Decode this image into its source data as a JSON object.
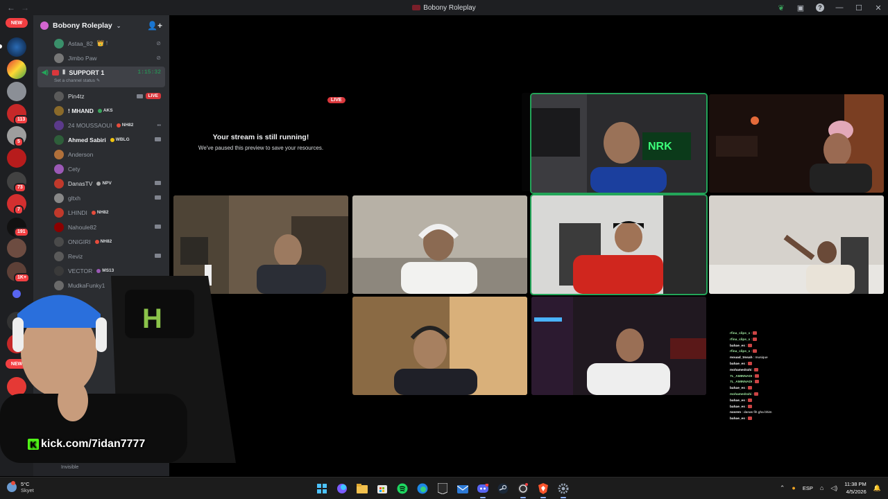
{
  "window": {
    "title": "Bobony Roleplay",
    "back_glyph": "←",
    "forward_glyph": "→",
    "controls": {
      "minimize": "—",
      "maximize": "☐",
      "close": "✕"
    },
    "icons": [
      "leaf-icon",
      "inbox-icon",
      "help-icon"
    ]
  },
  "rail": {
    "new_label": "NEW",
    "badges": [
      "113",
      "5",
      "73",
      "7",
      "191",
      "1K+"
    ]
  },
  "server": {
    "name": "Bobony Roleplay",
    "chevron": "⌄",
    "add_member_glyph": "👤+"
  },
  "voice_users_top": [
    {
      "name": "Astaa_82",
      "suffix": "👑 !"
    },
    {
      "name": "Jimbo Paw",
      "suffix": ""
    }
  ],
  "channel": {
    "name": "SUPPORT 1",
    "prefix": "Ⅱ",
    "timer": "1:15:32",
    "status": "Set a channel status ✎",
    "members": [
      {
        "name": "Pin4tz",
        "tag": "",
        "live": "LIVE"
      },
      {
        "name": "! MHAND",
        "tag": "AKS",
        "live": ""
      },
      {
        "name": "24 MOUSSAOUI",
        "tag": "NH82",
        "live": ""
      },
      {
        "name": "Ahmed Sabiri",
        "tag": "WBLG",
        "live": ""
      },
      {
        "name": "Anderson",
        "tag": "",
        "live": ""
      },
      {
        "name": "Cety",
        "tag": "",
        "live": ""
      },
      {
        "name": "DanasTV",
        "tag": "NPV",
        "live": ""
      },
      {
        "name": "gltxh",
        "tag": "",
        "live": ""
      },
      {
        "name": "LHINDI",
        "tag": "NH82",
        "live": ""
      },
      {
        "name": "Nahoule82",
        "tag": "",
        "live": ""
      },
      {
        "name": "ONIGIRI",
        "tag": "NH82",
        "live": ""
      },
      {
        "name": "Reviz",
        "tag": "",
        "live": ""
      },
      {
        "name": "VECTOR",
        "tag": "MS13",
        "live": ""
      },
      {
        "name": "MudkaFunky1",
        "tag": "",
        "live": ""
      }
    ]
  },
  "user_panel": {
    "status": "Invisible"
  },
  "stage": {
    "paused_title": "Your stream is still running!",
    "paused_sub": "We've paused this preview to save your resources.",
    "live_tag": "LIVE"
  },
  "chat_overlay": [
    {
      "user": "rfina_clips_x",
      "msg": "",
      "emoji": true
    },
    {
      "user": "rfina_clips_x",
      "msg": "",
      "emoji": true
    },
    {
      "user": "bahae_es",
      "msg": "",
      "emoji": true
    },
    {
      "user": "rfina_clips_x",
      "msg": "",
      "emoji": true
    },
    {
      "user": "mouad_tmsah",
      "msg": "musique",
      "emoji": false
    },
    {
      "user": "bahae_es",
      "msg": "",
      "emoji": true
    },
    {
      "user": "mohamedrahi",
      "msg": "",
      "emoji": true
    },
    {
      "user": "7L_AMINNADI",
      "msg": "",
      "emoji": true
    },
    {
      "user": "7L_AMINNADI",
      "msg": "",
      "emoji": true
    },
    {
      "user": "bahae_es",
      "msg": "",
      "emoji": true
    },
    {
      "user": "mohamedrahi",
      "msg": "",
      "emoji": true
    },
    {
      "user": "bahae_es",
      "msg": "",
      "emoji": true
    },
    {
      "user": "bahae_es",
      "msg": "",
      "emoji": true
    },
    {
      "user": "nosren",
      "msg": "danas fih gha bhim",
      "emoji": false
    },
    {
      "user": "bahae_es",
      "msg": "",
      "emoji": true
    }
  ],
  "overlay": {
    "kick_url": "kick.com/7idan7777",
    "kick_logo": "K"
  },
  "taskbar": {
    "weather_temp": "5°C",
    "weather_place": "Skyet",
    "lang": "ESP",
    "time": "11:38 PM",
    "date": "4/5/2026",
    "apps": [
      "windows-icon",
      "copilot-icon",
      "file-explorer-icon",
      "store-icon",
      "spotify-icon",
      "edge-icon",
      "epic-icon",
      "mail-icon",
      "discord-icon",
      "steam-icon",
      "obs-icon",
      "brave-icon",
      "settings-icon"
    ],
    "tray": {
      "chevron": "⌃",
      "mic": "🎙",
      "net": "⌂",
      "vol": "🔊"
    }
  },
  "colors": {
    "discord_bg": "#2b2d31",
    "rail_bg": "#1e1f22",
    "speaking": "#23a559",
    "live": "#da373c",
    "kick_green": "#53fc18"
  }
}
